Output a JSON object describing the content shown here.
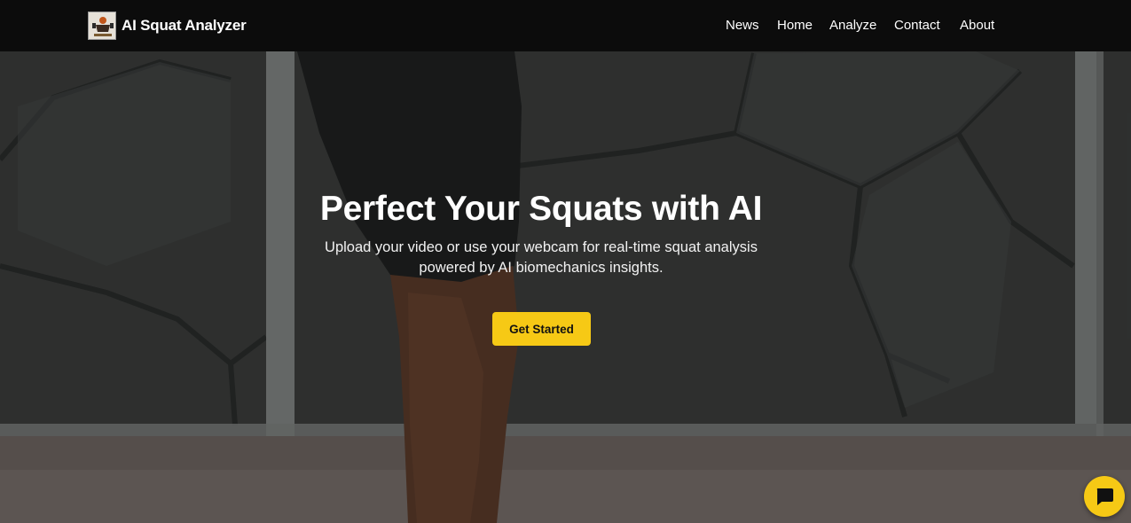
{
  "navbar": {
    "brand": "AI Squat Analyzer",
    "logo_icon": "fitness-logo-icon",
    "links": [
      {
        "label": "News"
      },
      {
        "label": "Home"
      },
      {
        "label": "Analyze"
      },
      {
        "label": "Contact"
      },
      {
        "label": "About"
      }
    ]
  },
  "hero": {
    "title": "Perfect Your Squats with AI",
    "subtitle": "Upload your video or use your webcam for real-time squat analysis powered by AI biomechanics insights.",
    "cta_label": "Get Started",
    "background": "gym-squat-video-background"
  },
  "chat": {
    "icon": "chat-bubble-icon"
  },
  "colors": {
    "accent": "#f6c915",
    "navbar_bg": "#080808",
    "text": "#ffffff"
  }
}
